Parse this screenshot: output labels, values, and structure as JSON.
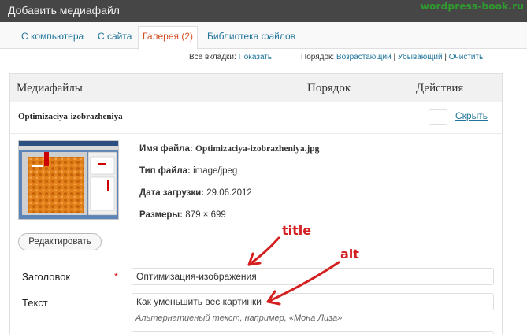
{
  "window": {
    "title": "Добавить медиафайл",
    "watermark": "wordpress-book.ru"
  },
  "tabs": [
    {
      "label": "С компьютера",
      "active": false
    },
    {
      "label": "С сайта",
      "active": false
    },
    {
      "label": "Галерея (2)",
      "active": true
    },
    {
      "label": "Библиотека файлов",
      "active": false
    }
  ],
  "controls": {
    "all_tabs_label": "Все вкладки:",
    "show_link": "Показать",
    "order_label": "Порядок:",
    "ascending": "Возрастающий",
    "separator": "|",
    "descending": "Убывающий",
    "clear": "Очистить"
  },
  "table": {
    "col_media": "Медиафайлы",
    "col_order": "Порядок",
    "col_actions": "Действия"
  },
  "item": {
    "name": "Optimizaciya-izobrazheniya",
    "hide_link": "Скрыть",
    "order_value": "",
    "file_name_label": "Имя файла:",
    "file_name": "Optimizaciya-izobrazheniya.jpg",
    "file_type_label": "Тип файла:",
    "file_type": "image/jpeg",
    "upload_date_label": "Дата загрузки:",
    "upload_date": "29.06.2012",
    "dimensions_label": "Размеры:",
    "dimensions": "879 × 699",
    "edit_button": "Редактировать"
  },
  "form": {
    "title_label": "Заголовок",
    "required_mark": "*",
    "title_value": "Оптимизация-изображения",
    "text_label": "Текст",
    "text_value": "Как уменьшить вес картинки",
    "text_hint": "Альтернатиеный текст, например, «Мона Лиза»"
  },
  "annotations": {
    "title_note": "title",
    "alt_note": "alt",
    "color": "#d42020"
  },
  "colors": {
    "link": "#21759b",
    "active_tab": "#d54e21",
    "titlebar": "#464646"
  }
}
